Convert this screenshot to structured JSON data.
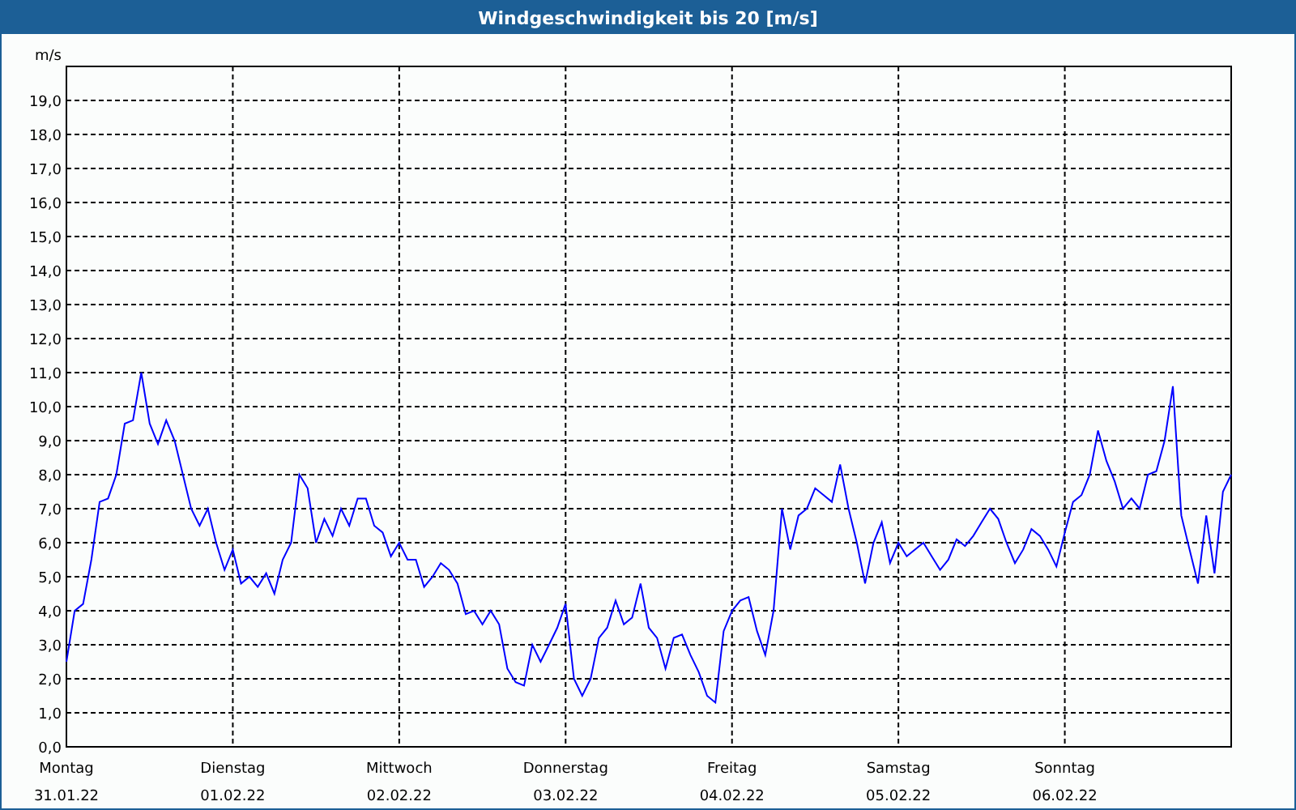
{
  "window": {
    "title": "Windgeschwindigkeit bis 20 [m/s]"
  },
  "chart": {
    "tick_dates": [
      "31.01.22",
      "01.02.22",
      "02.02.22",
      "03.02.22",
      "04.02.22",
      "05.02.22",
      "06.02.22"
    ],
    "chart_data": {
      "type": "line",
      "grid": true,
      "ylabel": "m/s",
      "ylim": [
        0,
        20
      ],
      "categories": [
        "Montag",
        null,
        null,
        null,
        null,
        null,
        null,
        null,
        null,
        null,
        null,
        null,
        null,
        null,
        null,
        null,
        null,
        null,
        null,
        null,
        "Dienstag",
        null,
        null,
        null,
        null,
        null,
        null,
        null,
        null,
        null,
        null,
        null,
        null,
        null,
        null,
        null,
        null,
        null,
        null,
        null,
        "Mittwoch",
        null,
        null,
        null,
        null,
        null,
        null,
        null,
        null,
        null,
        null,
        null,
        null,
        null,
        null,
        null,
        null,
        null,
        null,
        null,
        "Donnerstag",
        null,
        null,
        null,
        null,
        null,
        null,
        null,
        null,
        null,
        null,
        null,
        null,
        null,
        null,
        null,
        null,
        null,
        null,
        null,
        "Freitag",
        null,
        null,
        null,
        null,
        null,
        null,
        null,
        null,
        null,
        null,
        null,
        null,
        null,
        null,
        null,
        null,
        null,
        null,
        null,
        "Samstag",
        null,
        null,
        null,
        null,
        null,
        null,
        null,
        null,
        null,
        null,
        null,
        null,
        null,
        null,
        null,
        null,
        null,
        null,
        null,
        "Sonntag",
        null,
        null,
        null,
        null,
        null,
        null,
        null,
        null,
        null,
        null,
        null,
        null,
        null,
        null,
        null,
        null,
        null,
        null,
        null,
        null
      ],
      "yticks": [
        {
          "value": 0,
          "label": "0,0"
        },
        {
          "value": 1,
          "label": "1,0"
        },
        {
          "value": 2,
          "label": "2,0"
        },
        {
          "value": 3,
          "label": "3,0"
        },
        {
          "value": 4,
          "label": "4,0"
        },
        {
          "value": 5,
          "label": "5,0"
        },
        {
          "value": 6,
          "label": "6,0"
        },
        {
          "value": 7,
          "label": "7,0"
        },
        {
          "value": 8,
          "label": "8,0"
        },
        {
          "value": 9,
          "label": "9,0"
        },
        {
          "value": 10,
          "label": "10,0"
        },
        {
          "value": 11,
          "label": "11,0"
        },
        {
          "value": 12,
          "label": "12,0"
        },
        {
          "value": 13,
          "label": "13,0"
        },
        {
          "value": 14,
          "label": "14,0"
        },
        {
          "value": 15,
          "label": "15,0"
        },
        {
          "value": 16,
          "label": "16,0"
        },
        {
          "value": 17,
          "label": "17,0"
        },
        {
          "value": 18,
          "label": "18,0"
        },
        {
          "value": 19,
          "label": "19,0"
        }
      ],
      "series": [
        {
          "color": "#0000ff",
          "values": [
            2.5,
            4.0,
            4.2,
            5.5,
            7.2,
            7.3,
            8.0,
            9.5,
            9.6,
            11.0,
            9.5,
            8.9,
            9.6,
            9.0,
            8.0,
            7.0,
            6.5,
            7.0,
            6.0,
            5.2,
            5.8,
            4.8,
            5.0,
            4.7,
            5.1,
            4.5,
            5.5,
            6.0,
            8.0,
            7.6,
            6.0,
            6.7,
            6.2,
            7.0,
            6.5,
            7.3,
            7.3,
            6.5,
            6.3,
            5.6,
            6.0,
            5.5,
            5.5,
            4.7,
            5.0,
            5.4,
            5.2,
            4.8,
            3.9,
            4.0,
            3.6,
            4.0,
            3.6,
            2.3,
            1.9,
            1.8,
            3.0,
            2.5,
            3.0,
            3.5,
            4.2,
            2.0,
            1.5,
            2.0,
            3.2,
            3.5,
            4.3,
            3.6,
            3.8,
            4.8,
            3.5,
            3.2,
            2.3,
            3.2,
            3.3,
            2.7,
            2.2,
            1.5,
            1.3,
            3.4,
            4.0,
            4.3,
            4.4,
            3.4,
            2.7,
            4.0,
            7.0,
            5.8,
            6.8,
            7.0,
            7.6,
            7.4,
            7.2,
            8.3,
            7.0,
            6.0,
            4.8,
            6.0,
            6.6,
            5.4,
            6.0,
            5.6,
            5.8,
            6.0,
            5.6,
            5.2,
            5.5,
            6.1,
            5.9,
            6.2,
            6.6,
            7.0,
            6.7,
            6.0,
            5.4,
            5.8,
            6.4,
            6.2,
            5.8,
            5.3,
            6.3,
            7.2,
            7.4,
            8.0,
            9.3,
            8.4,
            7.8,
            7.0,
            7.3,
            7.0,
            8.0,
            8.1,
            9.0,
            10.6,
            6.8,
            5.8,
            4.8,
            6.8,
            5.1,
            7.5,
            8.0
          ]
        }
      ]
    }
  }
}
